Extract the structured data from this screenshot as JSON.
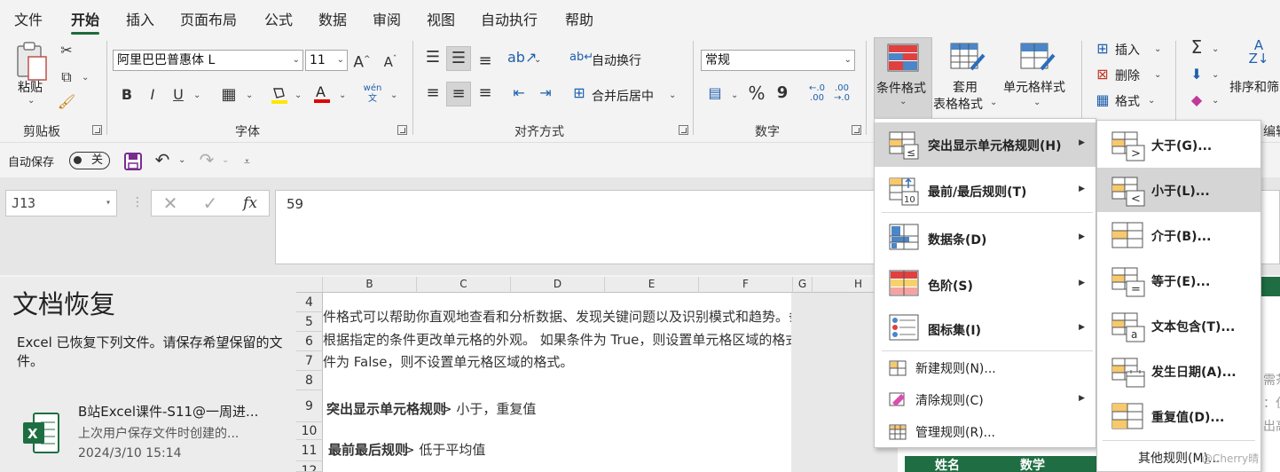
{
  "menu_tabs": [
    "文件",
    "开始",
    "插入",
    "页面布局",
    "公式",
    "数据",
    "审阅",
    "视图",
    "自动执行",
    "帮助"
  ],
  "ribbon": {
    "clipboard": {
      "paste": "粘贴",
      "group": "剪贴板"
    },
    "font": {
      "name": "阿里巴巴普惠体 L",
      "size": "11",
      "group": "字体",
      "bold": "B",
      "italic": "I",
      "underline": "U",
      "phonetic": "wén\n文"
    },
    "alignment": {
      "wrap": "自动换行",
      "merge": "合并后居中",
      "group": "对齐方式"
    },
    "number": {
      "format": "常规",
      "percent": "%",
      "comma": "9",
      "group": "数字"
    },
    "styles": {
      "conditional": "条件格式",
      "table_line1": "套用",
      "table_line2": "表格格式",
      "cell_styles": "单元格样式"
    },
    "cells": {
      "insert": "插入",
      "delete": "删除",
      "format": "格式"
    },
    "editing": {
      "sort": "排序和筛",
      "group": "编辑"
    }
  },
  "qat": {
    "autosave": "自动保存",
    "toggle_state": "关"
  },
  "formula_bar": {
    "name_box": "J13",
    "fx": "fx",
    "value": "59"
  },
  "recovery": {
    "title": "文档恢复",
    "desc": "Excel 已恢复下列文件。请保存希望保留的文件。",
    "file_name": "B站Excel课件-S11@一周进...",
    "file_sub": "上次用户保存文件时创建的...",
    "file_time": "2024/3/10 15:14"
  },
  "sheet": {
    "columns": [
      "B",
      "C",
      "D",
      "E",
      "F",
      "G",
      "H"
    ],
    "rows": [
      "4",
      "5",
      "6",
      "7",
      "8",
      "9",
      "10",
      "11",
      "12"
    ],
    "lines": [
      "件格式可以帮助你直观地查看和分析数据、发现关键问题以及识别模式和趋势。条",
      "根据指定的条件更改单元格的外观。 如果条件为 True，则设置单元格区域的格式。",
      "件为 False，则不设置单元格区域的格式。"
    ],
    "row9_bold": "突出显示单元格规则",
    "row9_rest": "> 小于，重复值",
    "row11_bold": "最前最后规则",
    "row11_rest": "> 低于平均值",
    "right_fragments": [
      "需茶",
      "：仅",
      "出高"
    ],
    "header_name": "姓名",
    "header_score": "数学"
  },
  "cf_menu": {
    "items": [
      {
        "label": "突出显示单元格规则(H)"
      },
      {
        "label": "最前/最后规则(T)"
      },
      {
        "label": "数据条(D)"
      },
      {
        "label": "色阶(S)"
      },
      {
        "label": "图标集(I)"
      }
    ],
    "small_items": [
      {
        "label": "新建规则(N)..."
      },
      {
        "label": "清除规则(C)"
      },
      {
        "label": "管理规则(R)..."
      }
    ]
  },
  "sub_menu": {
    "items": [
      {
        "label": "大于(G)..."
      },
      {
        "label": "小于(L)..."
      },
      {
        "label": "介于(B)..."
      },
      {
        "label": "等于(E)..."
      },
      {
        "label": "文本包含(T)..."
      },
      {
        "label": "发生日期(A)..."
      },
      {
        "label": "重复值(D)..."
      }
    ],
    "more": "其他规则(M)...",
    "watermark": "@Cherry晴"
  },
  "colors": {
    "accent": "#1e6b3a",
    "highlight": "#d5d5d5",
    "table_green": "#1f6e43"
  }
}
